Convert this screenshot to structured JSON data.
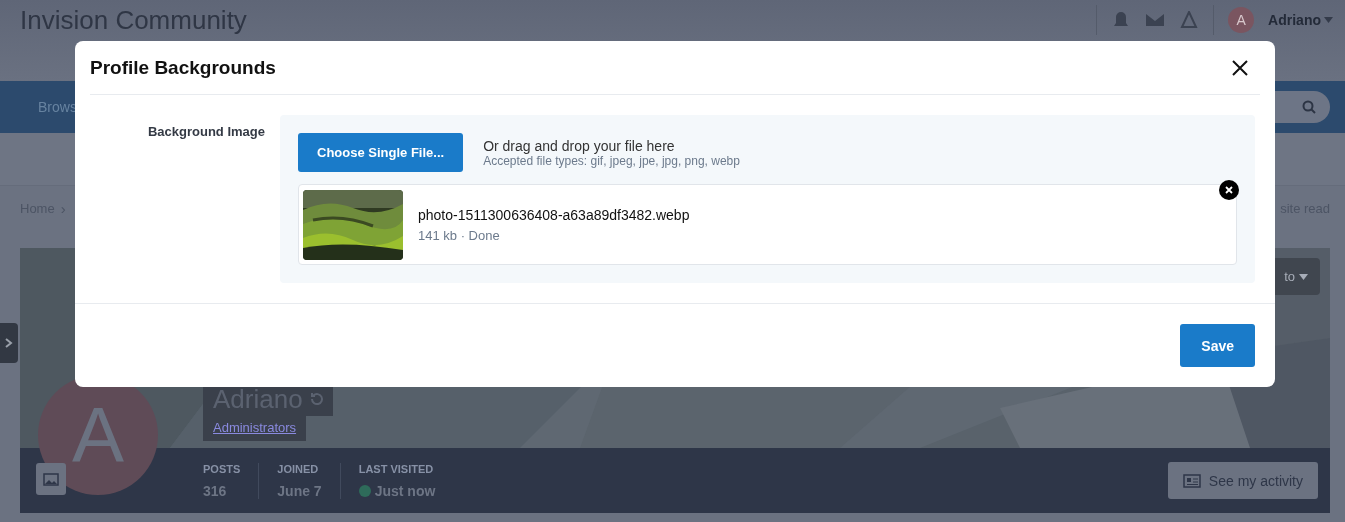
{
  "header": {
    "site_title": "Invision Community",
    "user_avatar_letter": "A",
    "user_name": "Adriano"
  },
  "nav": {
    "item": "Brows"
  },
  "breadcrumb": {
    "home": "Home",
    "separator": "›",
    "action": "site read"
  },
  "profile": {
    "cover_button": "to",
    "name": "Adriano",
    "group": "Administrators",
    "avatar_letter": "A",
    "stats": [
      {
        "label": "POSTS",
        "value": "316",
        "online": false
      },
      {
        "label": "JOINED",
        "value": "June 7",
        "online": false
      },
      {
        "label": "LAST VISITED",
        "value": "Just now",
        "online": true
      }
    ],
    "activity_button": "See my activity"
  },
  "modal": {
    "title": "Profile Backgrounds",
    "field_label": "Background Image",
    "choose_button": "Choose Single File...",
    "drop_hint": "Or drag and drop your file here",
    "accepted_types": "Accepted file types: gif, jpeg, jpe, jpg, png, webp",
    "files": [
      {
        "kind": "picture",
        "name": "photo-1511300636408-a63a89df3482.webp",
        "meta": "141 kb · Done"
      }
    ],
    "save_button": "Save"
  }
}
